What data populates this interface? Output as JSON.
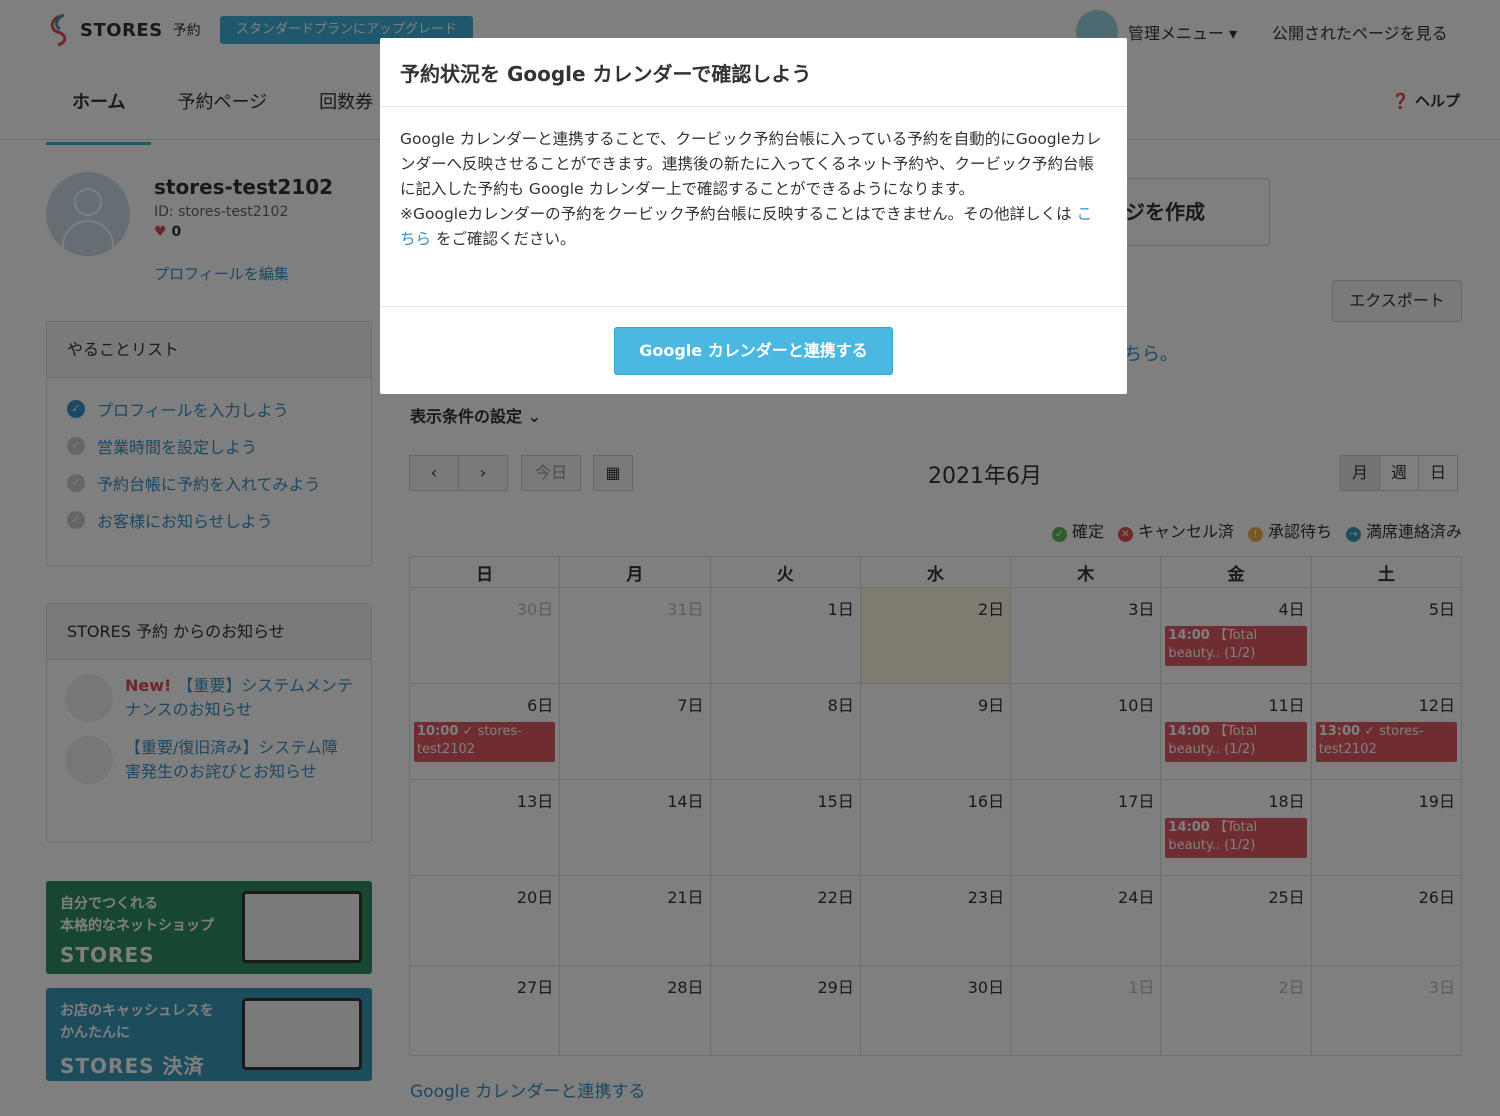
{
  "header": {
    "logo_text": "STORES",
    "logo_sub": "予約",
    "upgrade_label": "スタンダードプランにアップグレード",
    "admin_menu": "管理メニュー",
    "public_page": "公開されたページを見る",
    "help": "ヘルプ",
    "nav": [
      "ホーム",
      "予約ページ",
      "回数券"
    ]
  },
  "profile": {
    "name": "stores-test2102",
    "id": "ID: stores-test2102",
    "likes": "0",
    "edit": "プロフィールを編集"
  },
  "todo": {
    "title": "やることリスト",
    "items": [
      "プロフィールを入力しよう",
      "営業時間を設定しよう",
      "予約台帳に予約を入れてみよう",
      "お客様にお知らせしよう"
    ]
  },
  "news": {
    "title": "STORES 予約 からのお知らせ",
    "new_tag": "New!",
    "items": [
      "【重要】システムメンテナンスのお知らせ",
      "【重要/復旧済み】システム障害発生のお詫びとお知らせ"
    ]
  },
  "banners": [
    {
      "line1": "自分でつくれる",
      "line2": "本格的なネットショップ",
      "brand": "STORES",
      "color": "#2e8f63"
    },
    {
      "line1": "お店のキャッシュレスを",
      "line2": "かんたんに",
      "brand": "STORES 決済",
      "color": "#3a98b8"
    }
  ],
  "main": {
    "create_page": "ジを作成",
    "export": "エクスポート",
    "kochira_tail": "ちら。",
    "filter": "表示条件の設定",
    "today": "今日",
    "month_title": "2021年6月",
    "views": [
      "月",
      "週",
      "日"
    ],
    "gcal_link": "Google カレンダーと連携する"
  },
  "legend": [
    {
      "label": "確定",
      "color": "#5cb85c",
      "glyph": "✓"
    },
    {
      "label": "キャンセル済",
      "color": "#d9534f",
      "glyph": "✕"
    },
    {
      "label": "承認待ち",
      "color": "#f0ad4e",
      "glyph": "!"
    },
    {
      "label": "満席連絡済み",
      "color": "#3a98b8",
      "glyph": "→"
    }
  ],
  "calendar": {
    "weekdays": [
      "日",
      "月",
      "火",
      "水",
      "木",
      "金",
      "土"
    ],
    "weeks": [
      [
        {
          "d": "30日",
          "dim": true
        },
        {
          "d": "31日",
          "dim": true
        },
        {
          "d": "1日"
        },
        {
          "d": "2日",
          "today": true
        },
        {
          "d": "3日"
        },
        {
          "d": "4日",
          "ev": {
            "time": "14:00",
            "text": "【Total beauty.. (1/2)"
          }
        },
        {
          "d": "5日"
        }
      ],
      [
        {
          "d": "6日",
          "ev": {
            "time": "10:00",
            "check": true,
            "text": "stores-test2102"
          }
        },
        {
          "d": "7日"
        },
        {
          "d": "8日"
        },
        {
          "d": "9日"
        },
        {
          "d": "10日"
        },
        {
          "d": "11日",
          "ev": {
            "time": "14:00",
            "text": "【Total beauty.. (1/2)"
          }
        },
        {
          "d": "12日",
          "ev": {
            "time": "13:00",
            "check": true,
            "text": "stores-test2102"
          }
        }
      ],
      [
        {
          "d": "13日"
        },
        {
          "d": "14日"
        },
        {
          "d": "15日"
        },
        {
          "d": "16日"
        },
        {
          "d": "17日"
        },
        {
          "d": "18日",
          "ev": {
            "time": "14:00",
            "text": "【Total beauty.. (1/2)"
          }
        },
        {
          "d": "19日"
        }
      ],
      [
        {
          "d": "20日"
        },
        {
          "d": "21日"
        },
        {
          "d": "22日"
        },
        {
          "d": "23日"
        },
        {
          "d": "24日"
        },
        {
          "d": "25日"
        },
        {
          "d": "26日"
        }
      ],
      [
        {
          "d": "27日"
        },
        {
          "d": "28日"
        },
        {
          "d": "29日"
        },
        {
          "d": "30日"
        },
        {
          "d": "1日",
          "dim": true
        },
        {
          "d": "2日",
          "dim": true
        },
        {
          "d": "3日",
          "dim": true
        }
      ]
    ]
  },
  "modal": {
    "title": "予約状況を Google カレンダーで確認しよう",
    "body1": "Google カレンダーと連携することで、クービック予約台帳に入っている予約を自動的にGoogleカレンダーへ反映させることができます。連携後の新たに入ってくるネット予約や、クービック予約台帳に記入した予約も Google カレンダー上で確認することができるようになります。",
    "body2_pre": "※Googleカレンダーの予約をクービック予約台帳に反映することはできません。その他詳しくは ",
    "body2_link": "こちら",
    "body2_post": " をご確認ください。",
    "button": "Google カレンダーと連携する"
  }
}
